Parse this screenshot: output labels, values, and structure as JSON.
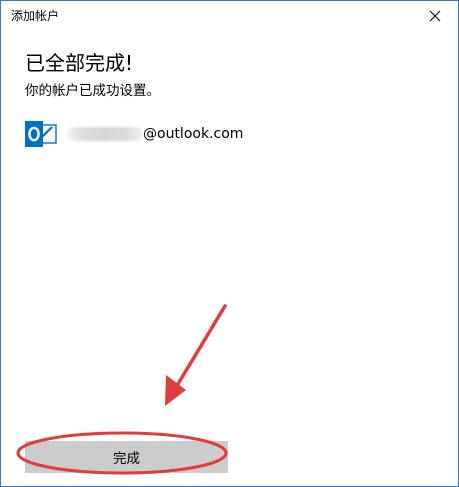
{
  "window": {
    "title": "添加帐户"
  },
  "content": {
    "heading": "已全部完成!",
    "subheading": "你的帐户已成功设置。",
    "account": {
      "icon": "outlook-icon",
      "email_domain": "@outlook.com"
    }
  },
  "footer": {
    "done_label": "完成"
  },
  "colors": {
    "outlook_blue": "#0072c6",
    "annotation_red": "#e03c3c",
    "button_bg": "#cccccc"
  }
}
